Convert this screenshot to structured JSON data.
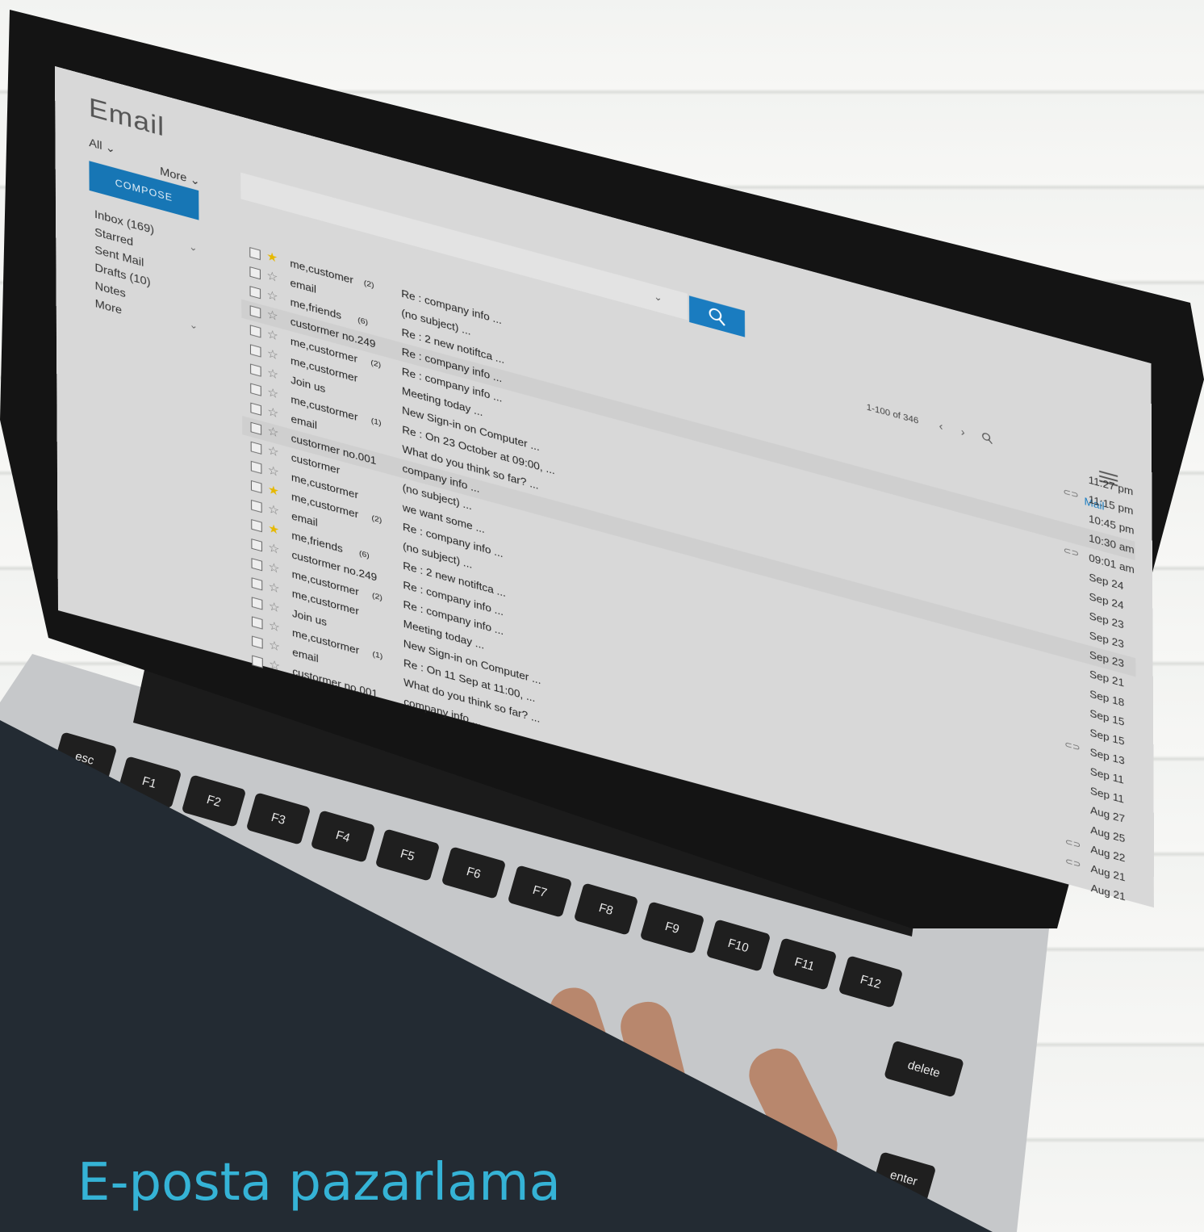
{
  "app": {
    "title": "Email"
  },
  "filters": {
    "all": "All",
    "more": "More"
  },
  "compose_label": "COMPOSE",
  "folders": [
    {
      "label": "Inbox",
      "count": "(169)"
    },
    {
      "label": "Starred",
      "count": ""
    },
    {
      "label": "Sent Mail",
      "count": ""
    },
    {
      "label": "Drafts",
      "count": "(10)"
    },
    {
      "label": "Notes",
      "count": ""
    },
    {
      "label": "More",
      "count": ""
    }
  ],
  "pagination": {
    "range": "1-100 of 346"
  },
  "tab": {
    "mail": "Mail"
  },
  "emails": [
    {
      "sender": "me,customer",
      "count": "(2)",
      "subject": "Re : company info ...",
      "time": "11:27 pm",
      "starred": true,
      "attachment": false
    },
    {
      "sender": "email",
      "count": "",
      "subject": "(no subject) ...",
      "time": "11:15 pm",
      "starred": false,
      "attachment": true
    },
    {
      "sender": "me,friends",
      "count": "(6)",
      "subject": "Re : 2 new notiftca ...",
      "time": "10:45 pm",
      "starred": false,
      "attachment": false
    },
    {
      "sender": "custormer no.249",
      "count": "",
      "subject": "Re : company info ...",
      "time": "10:30 am",
      "starred": false,
      "attachment": false
    },
    {
      "sender": "me,custormer",
      "count": "(2)",
      "subject": "Re : company info ...",
      "time": "09:01 am",
      "starred": false,
      "attachment": true
    },
    {
      "sender": "me,custormer",
      "count": "",
      "subject": "Meeting today ...",
      "time": "Sep 24",
      "starred": false,
      "attachment": false
    },
    {
      "sender": "Join us",
      "count": "",
      "subject": "New Sign-in on Computer ...",
      "time": "Sep 24",
      "starred": false,
      "attachment": false
    },
    {
      "sender": "me,custormer",
      "count": "(1)",
      "subject": "Re : On 23 October at 09:00, ...",
      "time": "Sep 23",
      "starred": false,
      "attachment": false
    },
    {
      "sender": "email",
      "count": "",
      "subject": "What do you think so far? ...",
      "time": "Sep 23",
      "starred": false,
      "attachment": false
    },
    {
      "sender": "custormer no.001",
      "count": "",
      "subject": "company info ...",
      "time": "Sep 23",
      "starred": false,
      "attachment": false
    },
    {
      "sender": "custormer",
      "count": "",
      "subject": "(no subject) ...",
      "time": "Sep 21",
      "starred": false,
      "attachment": false
    },
    {
      "sender": "me,custormer",
      "count": "",
      "subject": "we want some ...",
      "time": "Sep 18",
      "starred": false,
      "attachment": false
    },
    {
      "sender": "me,custormer",
      "count": "(2)",
      "subject": "Re : company info ...",
      "time": "Sep 15",
      "starred": true,
      "attachment": false
    },
    {
      "sender": "email",
      "count": "",
      "subject": "(no subject) ...",
      "time": "Sep 15",
      "starred": false,
      "attachment": false
    },
    {
      "sender": "me,friends",
      "count": "(6)",
      "subject": "Re : 2 new notiftca ...",
      "time": "Sep 13",
      "starred": true,
      "attachment": true
    },
    {
      "sender": "custormer no.249",
      "count": "",
      "subject": "Re : company info ...",
      "time": "Sep 11",
      "starred": false,
      "attachment": false
    },
    {
      "sender": "me,custormer",
      "count": "(2)",
      "subject": "Re : company info ...",
      "time": "Sep 11",
      "starred": false,
      "attachment": false
    },
    {
      "sender": "me,custormer",
      "count": "",
      "subject": "Meeting today ...",
      "time": "Aug 27",
      "starred": false,
      "attachment": false
    },
    {
      "sender": "Join us",
      "count": "",
      "subject": "New Sign-in on Computer ...",
      "time": "Aug 25",
      "starred": false,
      "attachment": false
    },
    {
      "sender": "me,custormer",
      "count": "(1)",
      "subject": "Re : On 11 Sep at 11:00, ...",
      "time": "Aug 22",
      "starred": false,
      "attachment": true
    },
    {
      "sender": "email",
      "count": "",
      "subject": "What do you think so far? ...",
      "time": "Aug 21",
      "starred": false,
      "attachment": true
    },
    {
      "sender": "custormer no.001",
      "count": "",
      "subject": "company info ...",
      "time": "Aug 21",
      "starred": false,
      "attachment": false
    }
  ],
  "keyboard": {
    "keys": [
      "esc",
      "F1",
      "F2",
      "F3",
      "F4",
      "F5",
      "F6",
      "F7",
      "F8",
      "F9",
      "F10",
      "F11",
      "F12",
      "delete",
      "enter"
    ]
  },
  "headline": {
    "line1": "E-posta pazarlama",
    "line2": ""
  },
  "colors": {
    "accent": "#1a7cc0",
    "panel": "#232b33",
    "headline": "#35b3d6"
  }
}
